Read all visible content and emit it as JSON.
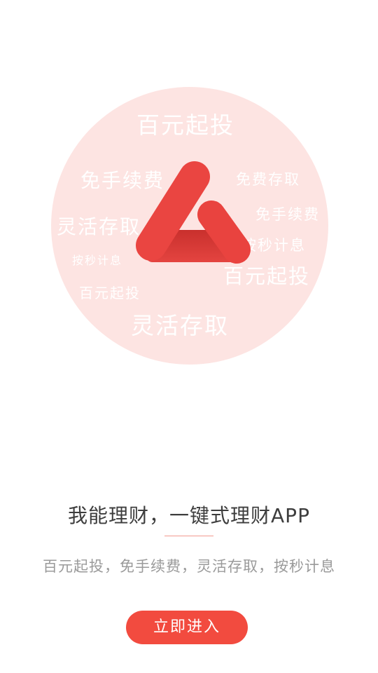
{
  "hero": {
    "watermarks": [
      "百元起投",
      "免手续费",
      "免费存取",
      "灵活存取",
      "免手续费",
      "按秒计息",
      "按秒计息",
      "百元起投",
      "百元起投",
      "灵活存取"
    ],
    "logo_icon": "brand-logo-icon"
  },
  "main": {
    "title": "我能理财，一键式理财APP",
    "subtitle": "百元起投，免手续费，灵活存取，按秒计息",
    "enter_button": "立即进入"
  },
  "colors": {
    "accent": "#f24b3f",
    "logo_red": "#e9433f",
    "circle_bg": "#fde4e2",
    "title_text": "#3d3d3d",
    "subtitle_text": "#9a9a9a",
    "divider": "#f29a8f"
  }
}
